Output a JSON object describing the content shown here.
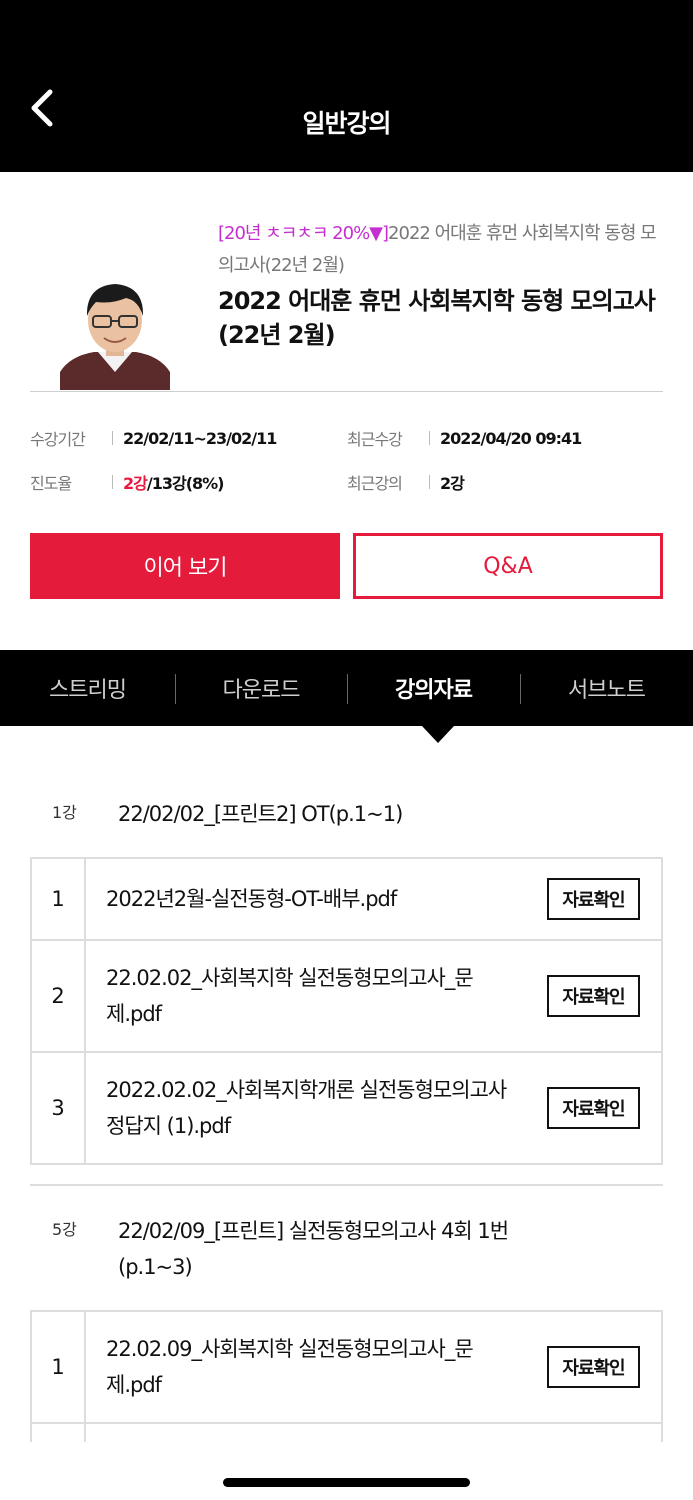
{
  "header": {
    "title": "일반강의",
    "back_icon": "chevron-left-icon"
  },
  "course": {
    "promo": "[20년 ㅊㅋㅊㅋ 20%▼]",
    "subtitle_rest": "2022 어대훈 휴먼 사회복지학 동형 모의고사(22년 2월)",
    "title": "2022 어대훈 휴먼 사회복지학 동형 모의고사(22년 2월)",
    "promo_color": "#c42fd0"
  },
  "stats": {
    "period_label": "수강기간",
    "period_value": "22/02/11~23/02/11",
    "recent_label": "최근수강",
    "recent_value": "2022/04/20 09:41",
    "progress_label": "진도율",
    "progress_done": "2강",
    "progress_rest": "/13강(8%)",
    "last_lecture_label": "최근강의",
    "last_lecture_value": "2강"
  },
  "buttons": {
    "continue": "이어 보기",
    "qa": "Q&A",
    "accent": "#e41b3b"
  },
  "tabs": [
    {
      "label": "스트리밍",
      "active": false
    },
    {
      "label": "다운로드",
      "active": false
    },
    {
      "label": "강의자료",
      "active": true
    },
    {
      "label": "서브노트",
      "active": false
    }
  ],
  "lectures": [
    {
      "num": "1강",
      "name": "22/02/02_[프린트2] OT(p.1~1)",
      "files": [
        {
          "idx": "1",
          "name": "2022년2월-실전동형-OT-배부.pdf",
          "action": "자료확인"
        },
        {
          "idx": "2",
          "name": "22.02.02_사회복지학 실전동형모의고사_문제.pdf",
          "action": "자료확인"
        },
        {
          "idx": "3",
          "name": "2022.02.02_사회복지학개론 실전동형모의고사 정답지 (1).pdf",
          "action": "자료확인"
        }
      ]
    },
    {
      "num": "5강",
      "name": "22/02/09_[프린트] 실전동형모의고사 4회 1번(p.1~3)",
      "files": [
        {
          "idx": "1",
          "name": "22.02.09_사회복지학 실전동형모의고사_문제.pdf",
          "action": "자료확인"
        }
      ]
    }
  ]
}
